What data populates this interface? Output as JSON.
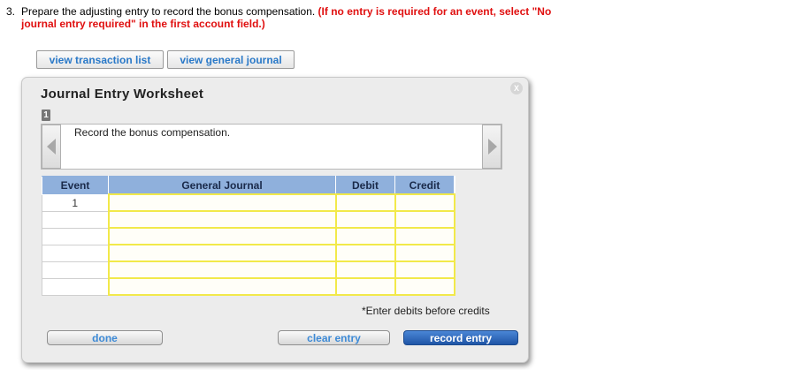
{
  "question": {
    "number": "3.",
    "text": "Prepare the adjusting entry to record the bonus compensation.",
    "warning": "(If no entry is required for an event, select \"No journal entry required\" in the first account field.)"
  },
  "toolbar": {
    "view_transactions": "view transaction list",
    "view_journal": "view general journal"
  },
  "worksheet": {
    "title": "Journal Entry Worksheet",
    "close_label": "X",
    "step": "1",
    "instruction": "Record the bonus compensation.",
    "columns": {
      "event": "Event",
      "account": "General Journal",
      "debit": "Debit",
      "credit": "Credit"
    },
    "rows": [
      {
        "event": "1"
      },
      {
        "event": ""
      },
      {
        "event": ""
      },
      {
        "event": ""
      },
      {
        "event": ""
      },
      {
        "event": ""
      }
    ],
    "note": "*Enter debits before credits",
    "buttons": {
      "done": "done",
      "clear": "clear entry",
      "record": "record entry"
    }
  },
  "colors": {
    "warning": "#e01010",
    "header_bg": "#8fb0dc",
    "cell_border": "#f2e94a",
    "link": "#2a79c8",
    "primary": "#1f55a6"
  }
}
